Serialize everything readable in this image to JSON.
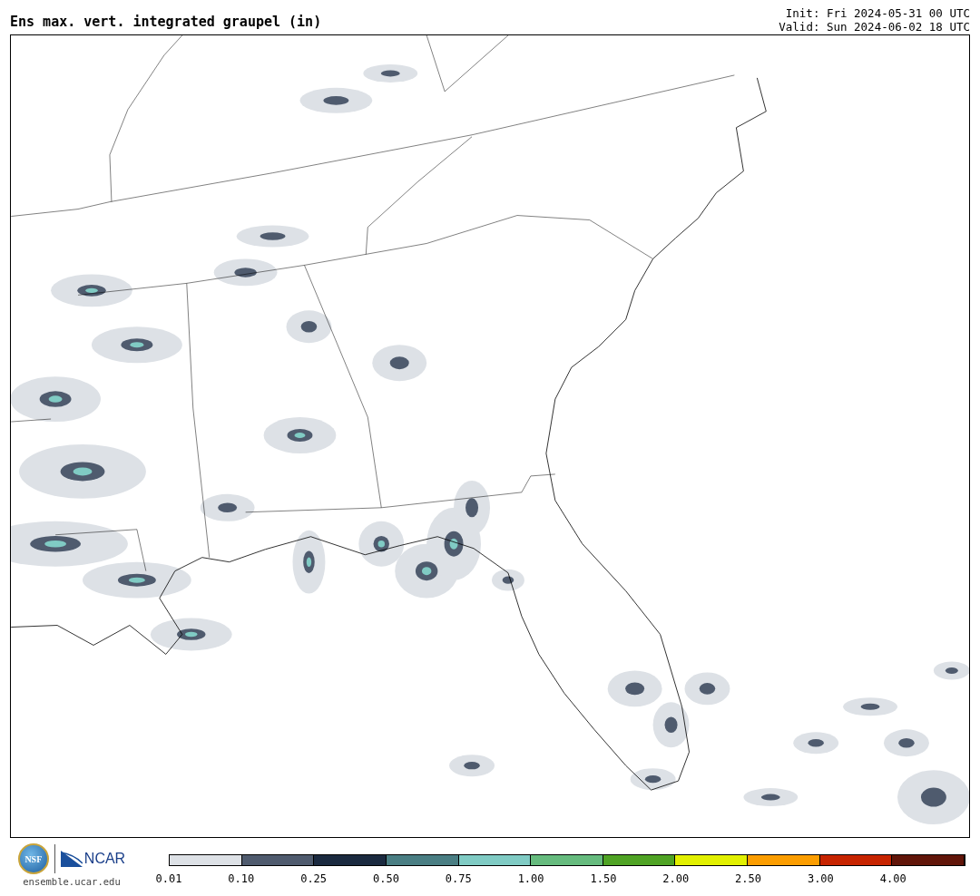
{
  "title": "Ens max. vert. integrated graupel (in)",
  "init": "Init: Fri 2024-05-31 00 UTC",
  "valid": "Valid: Sun 2024-06-02 18 UTC",
  "logos": {
    "nsf": "NSF",
    "ncar": "NCAR",
    "url": "ensemble.ucar.edu"
  },
  "colorbar": {
    "segments": [
      {
        "color": "#dde1e6"
      },
      {
        "color": "#4f5b6e"
      },
      {
        "color": "#1b2a40"
      },
      {
        "color": "#4a7e83"
      },
      {
        "color": "#80cbc4"
      },
      {
        "color": "#66bb7e"
      },
      {
        "color": "#4fa324"
      },
      {
        "color": "#e2f000"
      },
      {
        "color": "#fb9d00"
      },
      {
        "color": "#c72400"
      },
      {
        "color": "#611509"
      }
    ],
    "ticks": [
      "0.01",
      "0.10",
      "0.25",
      "0.50",
      "0.75",
      "1.00",
      "1.50",
      "2.00",
      "2.50",
      "3.00",
      "4.00"
    ]
  }
}
